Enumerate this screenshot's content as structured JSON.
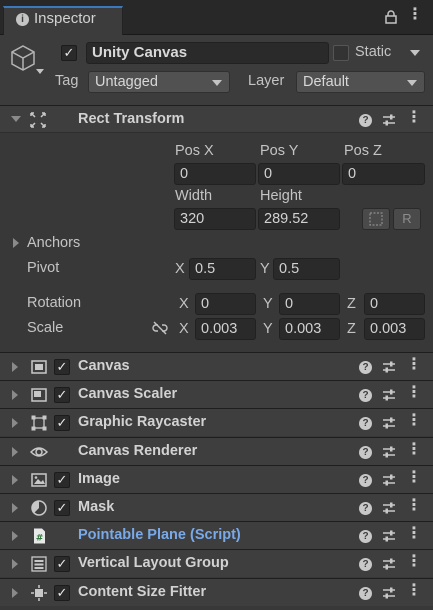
{
  "tab": {
    "title": "Inspector",
    "icon": "info-icon"
  },
  "object": {
    "active": true,
    "name": "Unity Canvas",
    "static_label": "Static",
    "static_checked": false,
    "tag_label": "Tag",
    "tag_value": "Untagged",
    "layer_label": "Layer",
    "layer_value": "Default"
  },
  "rect_transform": {
    "title": "Rect Transform",
    "pos_x_label": "Pos X",
    "pos_y_label": "Pos Y",
    "pos_z_label": "Pos Z",
    "pos_x": "0",
    "pos_y": "0",
    "pos_z": "0",
    "width_label": "Width",
    "height_label": "Height",
    "width": "320",
    "height": "289.52",
    "raw_button": "R",
    "anchors_label": "Anchors",
    "pivot_label": "Pivot",
    "pivot_x_label": "X",
    "pivot_x": "0.5",
    "pivot_y_label": "Y",
    "pivot_y": "0.5",
    "rotation_label": "Rotation",
    "rot_x_label": "X",
    "rot_x": "0",
    "rot_y_label": "Y",
    "rot_y": "0",
    "rot_z_label": "Z",
    "rot_z": "0",
    "scale_label": "Scale",
    "scale_x_label": "X",
    "scale_x": "0.003",
    "scale_y_label": "Y",
    "scale_y": "0.003",
    "scale_z_label": "Z",
    "scale_z": "0.003"
  },
  "components": [
    {
      "name": "Canvas",
      "icon": "canvas-icon",
      "has_checkbox": true,
      "checked": true,
      "script": false
    },
    {
      "name": "Canvas Scaler",
      "icon": "canvas-scaler-icon",
      "has_checkbox": true,
      "checked": true,
      "script": false
    },
    {
      "name": "Graphic Raycaster",
      "icon": "raycaster-icon",
      "has_checkbox": true,
      "checked": true,
      "script": false
    },
    {
      "name": "Canvas Renderer",
      "icon": "eye-icon",
      "has_checkbox": false,
      "checked": false,
      "script": false
    },
    {
      "name": "Image",
      "icon": "image-icon",
      "has_checkbox": true,
      "checked": true,
      "script": false
    },
    {
      "name": "Mask",
      "icon": "mask-icon",
      "has_checkbox": true,
      "checked": true,
      "script": false
    },
    {
      "name": "Pointable Plane (Script)",
      "icon": "script-icon",
      "has_checkbox": false,
      "checked": false,
      "script": true
    },
    {
      "name": "Vertical Layout Group",
      "icon": "layout-group-icon",
      "has_checkbox": true,
      "checked": true,
      "script": false
    },
    {
      "name": "Content Size Fitter",
      "icon": "size-fitter-icon",
      "has_checkbox": true,
      "checked": true,
      "script": false
    }
  ],
  "colors": {
    "accent": "#3a79bb",
    "script_title": "#7aa9e8",
    "background": "#383838"
  }
}
